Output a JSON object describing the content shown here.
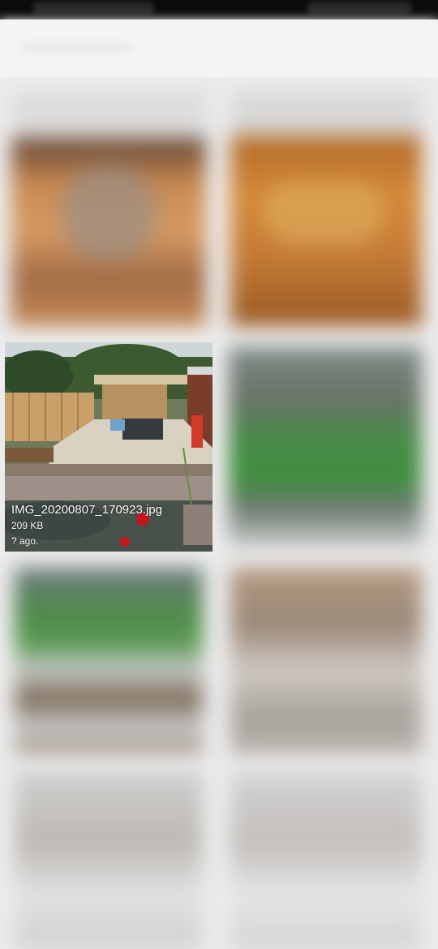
{
  "status_bar": {},
  "gallery": {
    "focused_item": {
      "file_name": "IMG_20200807_170923.jpg",
      "file_size": "209 KB",
      "age_text": "? ago."
    }
  },
  "colors": {
    "background": "#ececec",
    "caption_text": "#ffffff"
  }
}
